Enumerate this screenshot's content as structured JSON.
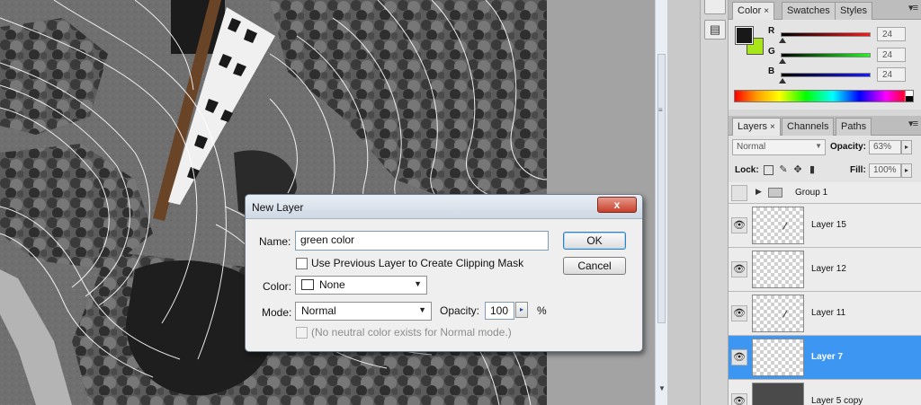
{
  "color_panel": {
    "tabs": [
      "Color",
      "Swatches",
      "Styles"
    ],
    "active_tab": "Color",
    "close_glyph": "×",
    "foreground_color": "#181818",
    "background_color": "#a8e619",
    "sliders": [
      {
        "label": "R",
        "value": "24",
        "gradient": "#000000,#ff1818"
      },
      {
        "label": "G",
        "value": "24",
        "gradient": "#000000,#18ff18"
      },
      {
        "label": "B",
        "value": "24",
        "gradient": "#000000,#1818ff"
      }
    ]
  },
  "layers_panel": {
    "tabs": [
      "Layers",
      "Channels",
      "Paths"
    ],
    "active_tab": "Layers",
    "close_glyph": "×",
    "blend_mode": "Normal",
    "opacity_label": "Opacity:",
    "opacity_value": "63%",
    "lock_label": "Lock:",
    "fill_label": "Fill:",
    "fill_value": "100%",
    "group_name": "Group 1",
    "layers": [
      {
        "name": "Layer 15",
        "selected": false
      },
      {
        "name": "Layer 12",
        "selected": false
      },
      {
        "name": "Layer 11",
        "selected": false
      },
      {
        "name": "Layer 7",
        "selected": true
      },
      {
        "name": "Layer 5 copy",
        "selected": false
      }
    ],
    "selection_color": "#3d97f2"
  },
  "dialog": {
    "title": "New Layer",
    "close_label": "x",
    "name_label": "Name:",
    "name_value": "green color",
    "clip_label": "Use Previous Layer to Create Clipping Mask",
    "color_label": "Color:",
    "color_value": "None",
    "mode_label": "Mode:",
    "mode_value": "Normal",
    "opacity_label": "Opacity:",
    "opacity_value": "100",
    "opacity_unit": "%",
    "neutral_label": "(No neutral color exists for Normal mode.)",
    "ok_label": "OK",
    "cancel_label": "Cancel"
  }
}
